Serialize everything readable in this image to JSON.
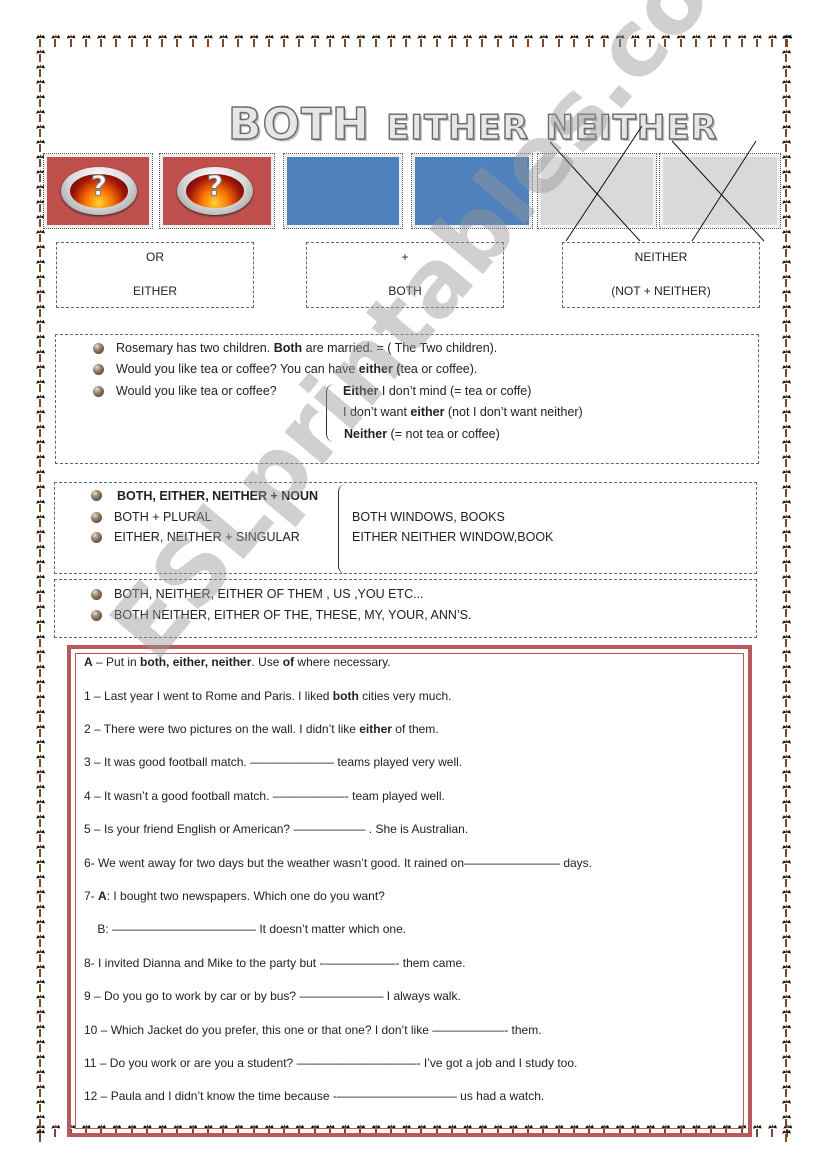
{
  "title": {
    "w1": "Both",
    "w2": "either",
    "w3": "neither"
  },
  "tiles": [
    {
      "color": "red",
      "icon": "question-icon",
      "glyph": "?"
    },
    {
      "color": "red",
      "icon": "question-icon",
      "glyph": "?"
    },
    {
      "color": "blue"
    },
    {
      "color": "blue"
    },
    {
      "color": "grey",
      "crossed": true
    },
    {
      "color": "grey",
      "crossed": true
    }
  ],
  "colors": {
    "red": "#c0504d",
    "blue": "#4f81bd",
    "grey": "#d9d9d9",
    "frame": "#b85a5a"
  },
  "legend_boxes": [
    {
      "top": "OR",
      "bottom": "EITHER"
    },
    {
      "top": "+",
      "bottom": "BOTH"
    },
    {
      "top": "NEITHER",
      "bottom": "(NOT + NEITHER)"
    }
  ],
  "examples": {
    "line1": {
      "a": "Rosemary has two children. ",
      "b": "Both",
      "c": " are married. = ( The Two children)."
    },
    "line2": {
      "a": "Would you like tea or coffee? You can have ",
      "b": "either (",
      "c": "tea or coffee)."
    },
    "line3": {
      "a": "Would you like tea or coffee?"
    },
    "brace": [
      {
        "b": "Either",
        "c": " I don’t mind (= tea or coffe)"
      },
      {
        "a": " I don’t want ",
        "b": "either",
        "c": " (not I don’t want neither)"
      },
      {
        "b": "Neither",
        "c": " (= not tea or coffee)"
      }
    ]
  },
  "noun_rules": {
    "heading": "BOTH, EITHER, NEITHER + NOUN",
    "left": [
      "BOTH + PLURAL",
      "EITHER, NEITHER + SINGULAR"
    ],
    "right": [
      "BOTH WINDOWS, BOOKS",
      "EITHER NEITHER WINDOW,BOOK"
    ]
  },
  "of_rules": [
    "BOTH, NEITHER, EITHER  OF THEM , US ,YOU ETC...",
    "BOTH NEITHER, EITHER OF THE, THESE, MY, YOUR, ANN’S."
  ],
  "exercise": {
    "instruction": {
      "a": "A",
      "b": " – Put in ",
      "c": "both, either, neither",
      "d": ". Use ",
      "e": "of",
      "f": " where necessary."
    },
    "items": [
      {
        "a": "1 – Last year I went to Rome and Paris. I liked ",
        "b": "both",
        "c": " cities very much."
      },
      {
        "a": "2 – There were two pictures on the wall. I didn’t like ",
        "b": "either",
        "c": " of them."
      },
      {
        "a": "3 – It was good football match. ——————— teams played very well."
      },
      {
        "a": "4 – It wasn’t a good football match. ——————- team played well."
      },
      {
        "a": "5 – Is your friend English or American? —————— . She is Australian."
      },
      {
        "a": "6- We went away for two days but the weather  wasn’t  good. It rained on———————— days."
      },
      {
        "a": "7- ",
        "b": "A",
        "c": ": I bought two newspapers. Which one do you want?"
      },
      {
        "a": "    B: ———————————— It doesn’t matter which one."
      },
      {
        "a": "8- I invited Dianna and Mike to the party but -——————- them came."
      },
      {
        "a": "9 – Do you go to work by car or by bus? ——————— I always walk."
      },
      {
        "a": "10 – Which Jacket do you prefer, this one or that one? I don’t like ——————- them."
      },
      {
        "a": "11 – Do you work or are you a student? ——————————- I’ve got a job and I study too."
      },
      {
        "a": "12 – Paula and I didn’t know the time because -—————————— us had a watch."
      }
    ]
  },
  "watermark": {
    "text1": "ESLprintables",
    "text2": ".com"
  }
}
